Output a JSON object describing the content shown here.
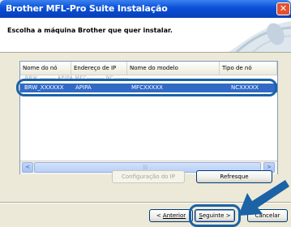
{
  "window": {
    "title": "Brother MFL-Pro Suite Instalação",
    "close_symbol": "✕"
  },
  "header": {
    "heading": "Escolha a máquina Brother que quer instalar."
  },
  "list": {
    "columns": [
      "Nome do nó",
      "Endereço de IP",
      "Nome do modelo",
      "Tipo de nó"
    ],
    "hidden_row_text": "BRW_------- APIPA MFC-------- NC-------",
    "selected_row": {
      "node_name": "BRW_XXXXXX",
      "ip": "APIPA",
      "model": "MFCXXXXX",
      "node_type": "NCXXXXX"
    },
    "scroll_left": "<",
    "scroll_right": ">",
    "scroll_grip": "|||"
  },
  "buttons": {
    "ip_config": "Configuração do IP",
    "refresh": "Refresque",
    "back": "Anterior",
    "back_prefix": "< ",
    "next": "eguinte >",
    "next_accel": "S",
    "cancel": "Cancelar"
  },
  "colors": {
    "highlight": "#1b62a6",
    "selection": "#316ac5",
    "titlebar": "#0a4fd6"
  },
  "icons": [
    "close-icon",
    "brand-graphic",
    "pointer-arrow-icon"
  ]
}
